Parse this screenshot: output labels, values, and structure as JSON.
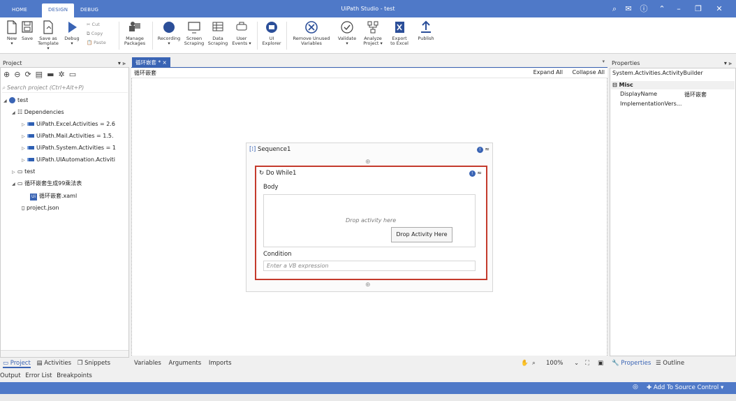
{
  "titlebar": {
    "tabs": [
      "HOME",
      "DESIGN",
      "DEBUG"
    ],
    "title": "UiPath Studio - test",
    "colors": {
      "bar": "#4f79c8",
      "accent": "#3a64b4",
      "highlight": "#c43a2c"
    }
  },
  "ribbon": {
    "new": "New",
    "save": "Save",
    "save_as_template": [
      "Save as",
      "Template"
    ],
    "debug": "Debug",
    "cut": "Cut",
    "copy": "Copy",
    "paste": "Paste",
    "manage_packages": [
      "Manage",
      "Packages"
    ],
    "recording": "Recording",
    "screen_scraping": [
      "Screen",
      "Scraping"
    ],
    "data_scraping": [
      "Data",
      "Scraping"
    ],
    "user_events": [
      "User",
      "Events"
    ],
    "ui_explorer": [
      "UI",
      "Explorer"
    ],
    "remove_unused": [
      "Remove Unused",
      "Variables"
    ],
    "validate": "Validate",
    "analyze_project": [
      "Analyze",
      "Project"
    ],
    "export_excel": [
      "Export",
      "to Excel"
    ],
    "publish": "Publish"
  },
  "project": {
    "header": "Project",
    "search_placeholder": "Search project (Ctrl+Alt+P)",
    "root": "test",
    "dependencies": "Dependencies",
    "packages": [
      "UiPath.Excel.Activities = 2.6",
      "UiPath.Mail.Activities = 1.5.",
      "UiPath.System.Activities = 1",
      "UiPath.UIAutomation.Activiti"
    ],
    "folders": [
      "test",
      "循环嵌套生成99乘法表"
    ],
    "xaml_file": "循环嵌套.xaml",
    "json_file": "project.json",
    "bottom_tabs": [
      "Project",
      "Activities",
      "Snippets"
    ]
  },
  "designer": {
    "tab_label": "循环嵌套 * ×",
    "breadcrumb": "循环嵌套",
    "expand_all": "Expand All",
    "collapse_all": "Collapse All",
    "sequence_title": "Sequence1",
    "dowhile_title": "Do While1",
    "body_label": "Body",
    "drop_text": "Drop activity here",
    "drop_button": "Drop Activity Here",
    "condition_label": "Condition",
    "condition_placeholder": "Enter a VB expression",
    "bottom_tabs": [
      "Variables",
      "Arguments",
      "Imports"
    ],
    "zoom": "100%"
  },
  "properties": {
    "header": "Properties",
    "type": "System.Activities.ActivityBuilder",
    "category": "Misc",
    "rows": [
      {
        "name": "DisplayName",
        "value": "循环嵌套"
      },
      {
        "name": "ImplementationVers...",
        "value": ""
      }
    ],
    "bottom_tabs": [
      "Properties",
      "Outline"
    ]
  },
  "output_tabs": [
    "Output",
    "Error List",
    "Breakpoints"
  ],
  "statusbar": {
    "source_control": "Add To Source Control"
  }
}
